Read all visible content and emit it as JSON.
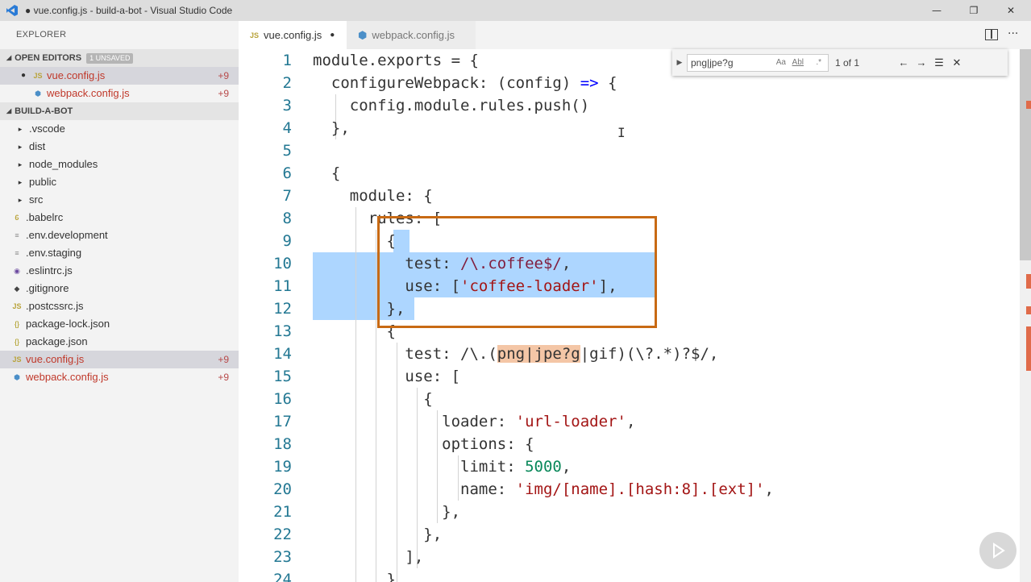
{
  "window": {
    "title": "● vue.config.js - build-a-bot - Visual Studio Code",
    "minimize": "—",
    "maximize": "❐",
    "close": "✕"
  },
  "sidebar": {
    "title": "EXPLORER",
    "open_editors": {
      "label": "OPEN EDITORS",
      "badge": "1 UNSAVED",
      "items": [
        {
          "name": "vue.config.js",
          "count": "+9",
          "icon": "js-icon",
          "dirty": true
        },
        {
          "name": "webpack.config.js",
          "count": "+9",
          "icon": "webpack-icon"
        }
      ]
    },
    "project": {
      "label": "BUILD-A-BOT",
      "items": [
        {
          "name": ".vscode",
          "type": "folder"
        },
        {
          "name": "dist",
          "type": "folder"
        },
        {
          "name": "node_modules",
          "type": "folder"
        },
        {
          "name": "public",
          "type": "folder"
        },
        {
          "name": "src",
          "type": "folder"
        },
        {
          "name": ".babelrc",
          "type": "file",
          "icon": "babel-icon"
        },
        {
          "name": ".env.development",
          "type": "file",
          "icon": "lines-icon"
        },
        {
          "name": ".env.staging",
          "type": "file",
          "icon": "lines-icon"
        },
        {
          "name": ".eslintrc.js",
          "type": "file",
          "icon": "eslint-icon"
        },
        {
          "name": ".gitignore",
          "type": "file",
          "icon": "git-icon"
        },
        {
          "name": ".postcssrc.js",
          "type": "file",
          "icon": "js-icon"
        },
        {
          "name": "package-lock.json",
          "type": "file",
          "icon": "json-icon"
        },
        {
          "name": "package.json",
          "type": "file",
          "icon": "json-icon"
        },
        {
          "name": "vue.config.js",
          "type": "file",
          "icon": "js-icon",
          "count": "+9"
        },
        {
          "name": "webpack.config.js",
          "type": "file",
          "icon": "webpack-icon",
          "count": "+9"
        }
      ]
    }
  },
  "tabs": [
    {
      "label": "vue.config.js",
      "icon_text": "JS",
      "dirty_mark": "●"
    },
    {
      "label": "webpack.config.js"
    }
  ],
  "find": {
    "query": "png|jpe?g",
    "match_case": "Aa",
    "whole_word": "Abl",
    "regex": ".*",
    "result": "1 of 1",
    "prev": "←",
    "next": "→",
    "in_selection": "☰",
    "close": "✕"
  },
  "editor": {
    "line_numbers": [
      "1",
      "2",
      "3",
      "4",
      "5",
      "6",
      "7",
      "8",
      "9",
      "10",
      "11",
      "12",
      "13",
      "14",
      "15",
      "16",
      "17",
      "18",
      "19",
      "20",
      "21",
      "22",
      "23",
      "24"
    ],
    "lines": [
      "module.exports = {",
      "  configureWebpack: (config) => {",
      "    config.module.rules.push()",
      "  },",
      "",
      "  {",
      "    module: {",
      "      rules: [",
      "        {",
      "          test: /\\.coffee$/,",
      "          use: ['coffee-loader'],",
      "        },",
      "        {",
      "          test: /\\.(png|jpe?g|gif)(\\?.*)?$/,",
      "          use: [",
      "            {",
      "              loader: 'url-loader',",
      "              options: {",
      "                limit: 5000,",
      "                name: 'img/[name].[hash:8].[ext]',",
      "              },",
      "            },",
      "          ],",
      "        }"
    ]
  },
  "colors": {
    "selection": "#add6ff",
    "annotation_box": "#c86a14",
    "find_match": "#f4c6a6",
    "keyword": "#0000ff",
    "string": "#a31515"
  }
}
